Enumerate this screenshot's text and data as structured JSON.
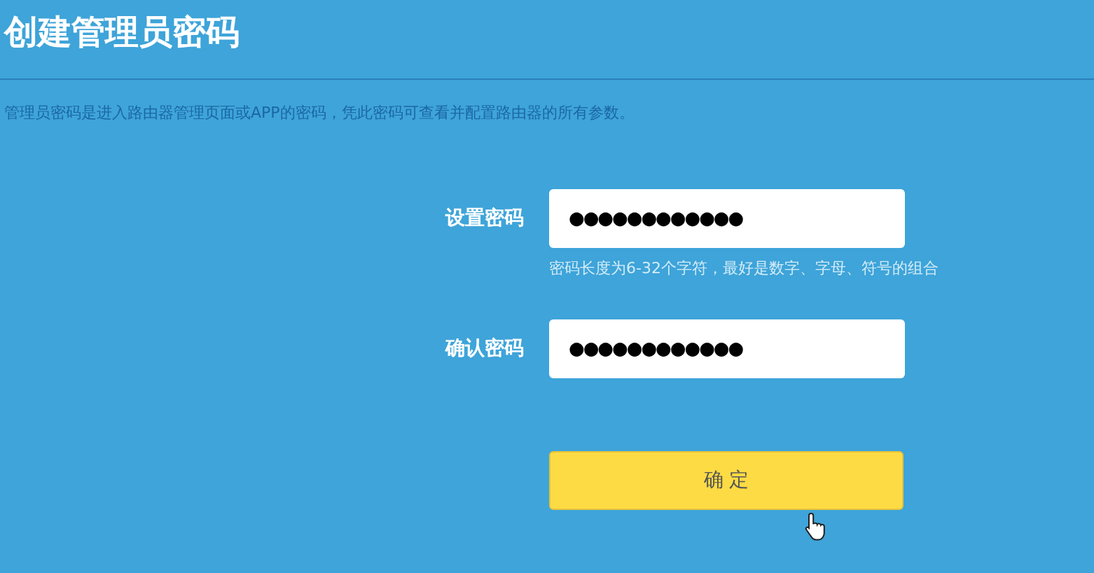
{
  "title": "创建管理员密码",
  "description": "管理员密码是进入路由器管理页面或APP的密码，凭此密码可查看并配置路由器的所有参数。",
  "fields": [
    {
      "label": "设置密码",
      "value": "●●●●●●●●●●●●",
      "hint": "密码长度为6-32个字符，最好是数字、字母、符号的组合"
    },
    {
      "label": "确认密码",
      "value": "●●●●●●●●●●●●"
    }
  ],
  "confirm_button": "确 定"
}
